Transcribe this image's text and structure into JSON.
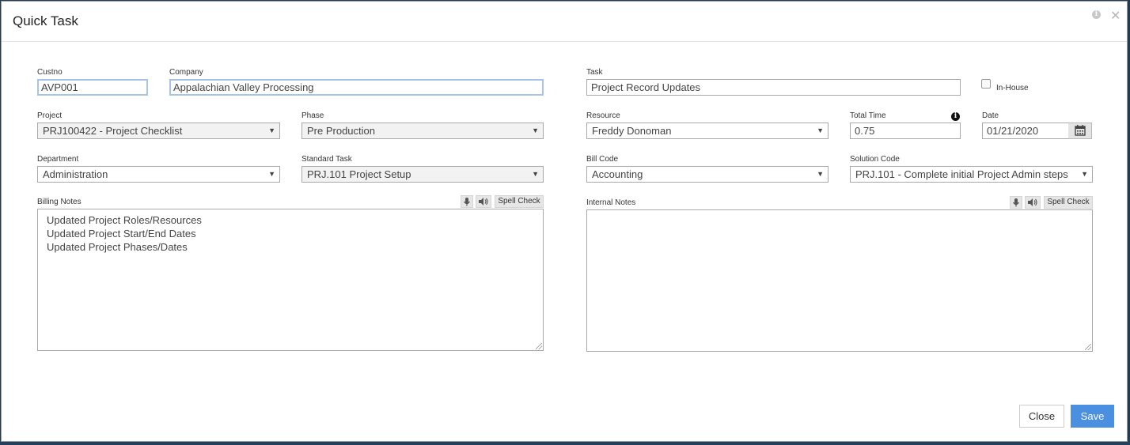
{
  "dialog": {
    "title": "Quick Task"
  },
  "fields": {
    "custno": {
      "label": "Custno",
      "value": "AVP001"
    },
    "company": {
      "label": "Company",
      "value": "Appalachian Valley Processing"
    },
    "task": {
      "label": "Task",
      "value": "Project Record Updates"
    },
    "inhouse": {
      "label": "In-House",
      "checked": false
    },
    "project": {
      "label": "Project",
      "value": "PRJ100422 - Project Checklist"
    },
    "phase": {
      "label": "Phase",
      "value": "Pre Production"
    },
    "resource": {
      "label": "Resource",
      "value": "Freddy Donoman"
    },
    "total_time": {
      "label": "Total Time",
      "value": "0.75"
    },
    "date": {
      "label": "Date",
      "value": "01/21/2020"
    },
    "department": {
      "label": "Department",
      "value": "Administration"
    },
    "standard_task": {
      "label": "Standard Task",
      "value": "PRJ.101 Project Setup"
    },
    "bill_code": {
      "label": "Bill Code",
      "value": "Accounting"
    },
    "solution_code": {
      "label": "Solution Code",
      "value": "PRJ.101 - Complete initial Project Admin steps"
    }
  },
  "billing_notes": {
    "label": "Billing Notes",
    "lines": [
      "Updated Project Roles/Resources",
      "Updated Project Start/End Dates",
      "Updated Project Phases/Dates"
    ],
    "spell_check": "Spell Check"
  },
  "internal_notes": {
    "label": "Internal Notes",
    "lines": [],
    "spell_check": "Spell Check"
  },
  "footer": {
    "close_label": "Close",
    "save_label": "Save"
  },
  "icons": {
    "info": "info-icon",
    "close": "close-icon",
    "calendar": "calendar-icon",
    "mic": "microphone-icon",
    "speaker": "speaker-icon",
    "dropdown": "chevron-down-icon"
  },
  "colors": {
    "primary_button": "#4a8fe0",
    "focus_border": "#a7c4e6"
  }
}
